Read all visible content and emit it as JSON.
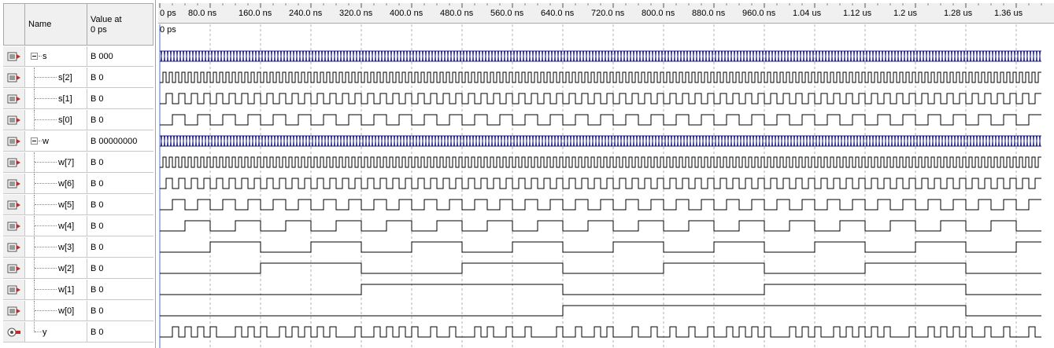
{
  "header": {
    "name_label": "Name",
    "value_label_line1": "Value at",
    "value_label_line2": "0 ps"
  },
  "cursor": {
    "label": "0 ps"
  },
  "time_axis": {
    "unit_note": "ps",
    "ticks": [
      "0 ps",
      "80.0 ns",
      "160.0 ns",
      "240.0 ns",
      "320.0 ns",
      "400.0 ns",
      "480.0 ns",
      "560.0 ns",
      "640.0 ns",
      "720.0 ns",
      "800.0 ns",
      "880.0 ns",
      "960.0 ns",
      "1.04 us",
      "1.12 us",
      "1.2 us",
      "1.28 us",
      "1.36 us"
    ],
    "tick_values_ns": [
      0,
      80,
      160,
      240,
      320,
      400,
      480,
      560,
      640,
      720,
      800,
      880,
      960,
      1040,
      1120,
      1200,
      1280,
      1360
    ],
    "visible_end_ns": 1400
  },
  "signals": [
    {
      "name": "s",
      "value": "B 000",
      "kind": "bus",
      "expandable": true,
      "direction": "input",
      "period_ns": 10
    },
    {
      "name": "s[2]",
      "value": "B 0",
      "kind": "bit",
      "child": true,
      "direction": "input",
      "period_ns": 10
    },
    {
      "name": "s[1]",
      "value": "B 0",
      "kind": "bit",
      "child": true,
      "direction": "input",
      "period_ns": 20
    },
    {
      "name": "s[0]",
      "value": "B 0",
      "kind": "bit",
      "child": true,
      "direction": "input",
      "period_ns": 40
    },
    {
      "name": "w",
      "value": "B 00000000",
      "kind": "bus",
      "expandable": true,
      "direction": "input",
      "period_ns": 10
    },
    {
      "name": "w[7]",
      "value": "B 0",
      "kind": "bit",
      "child": true,
      "direction": "input",
      "period_ns": 10
    },
    {
      "name": "w[6]",
      "value": "B 0",
      "kind": "bit",
      "child": true,
      "direction": "input",
      "period_ns": 20
    },
    {
      "name": "w[5]",
      "value": "B 0",
      "kind": "bit",
      "child": true,
      "direction": "input",
      "period_ns": 40
    },
    {
      "name": "w[4]",
      "value": "B 0",
      "kind": "bit",
      "child": true,
      "direction": "input",
      "period_ns": 80
    },
    {
      "name": "w[3]",
      "value": "B 0",
      "kind": "bit",
      "child": true,
      "direction": "input",
      "period_ns": 160
    },
    {
      "name": "w[2]",
      "value": "B 0",
      "kind": "bit",
      "child": true,
      "direction": "input",
      "period_ns": 320
    },
    {
      "name": "w[1]",
      "value": "B 0",
      "kind": "bit",
      "child": true,
      "direction": "input",
      "period_ns": 640
    },
    {
      "name": "w[0]",
      "value": "B 0",
      "kind": "bit",
      "child": true,
      "direction": "input",
      "period_ns": 1280
    },
    {
      "name": "y",
      "value": "B 0",
      "kind": "bit",
      "child": false,
      "direction": "output",
      "period_ns": 0
    }
  ],
  "colors": {
    "bus": "#1c1c80",
    "wave": "#000000",
    "grid": "#b0b0b0",
    "header_bg": "#f0f0f0"
  }
}
